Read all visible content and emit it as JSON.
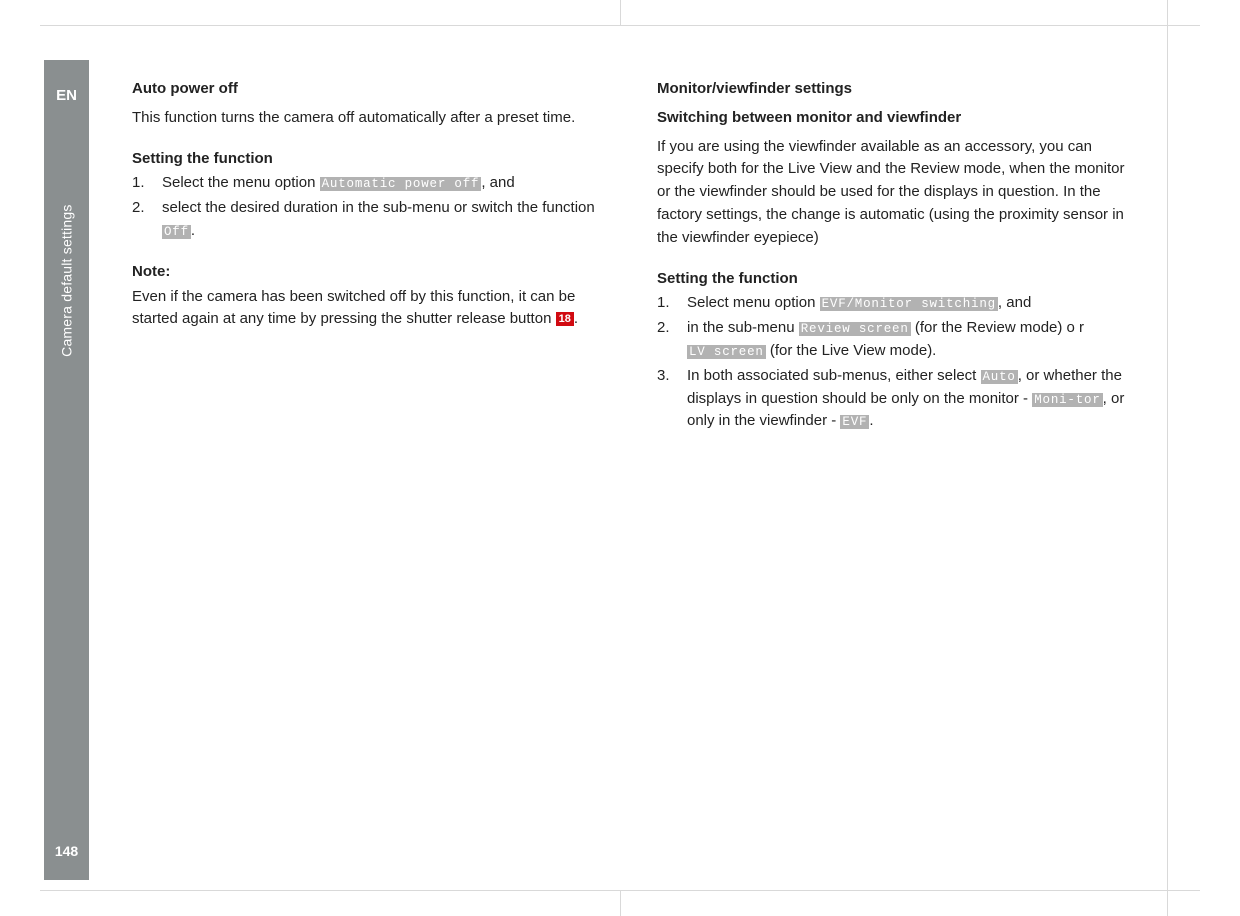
{
  "sidebar": {
    "lang": "EN",
    "section": "Camera default settings",
    "page": "148"
  },
  "left": {
    "h1": "Auto power off",
    "intro": "This function turns the camera off automatically after a preset time.",
    "setting_h": "Setting the function",
    "step1_a": "Select the menu option ",
    "step1_opt": "Automatic power off",
    "step1_b": ", and",
    "step2_a": "select the desired duration in the sub-menu or switch the function ",
    "step2_opt": "Off",
    "step2_b": ".",
    "note_h": "Note:",
    "note_a": "Even if the camera has been switched off by this function, it can be started again at any time by pressing the shutter release button ",
    "note_ref": "18",
    "note_b": "."
  },
  "right": {
    "h1": "Monitor/viewfinder settings",
    "h2": "Switching between monitor and viewfinder",
    "intro": "If you are using the viewfinder available as an accessory, you can specify both for the Live View and the Review mode, when the monitor or the viewfinder should be used for the displays in question. In the factory settings, the change is automatic (using the proximity sensor in the viewfinder eyepiece)",
    "setting_h": "Setting the function",
    "s1_a": "Select menu option ",
    "s1_opt": "EVF/Monitor switching",
    "s1_b": ", and",
    "s2_a": "in the sub-menu ",
    "s2_opt1": "Review screen",
    "s2_b": " (for the Review mode) o r ",
    "s2_opt2": "LV screen",
    "s2_c": " (for the Live View mode).",
    "s3_a": "In both associated sub-menus, either select ",
    "s3_opt1": "Auto",
    "s3_b": ", or whether the displays in question should be only on the monitor - ",
    "s3_opt2": "Moni-tor",
    "s3_c": ", or only in the viewfinder - ",
    "s3_opt3": "EVF",
    "s3_d": "."
  }
}
